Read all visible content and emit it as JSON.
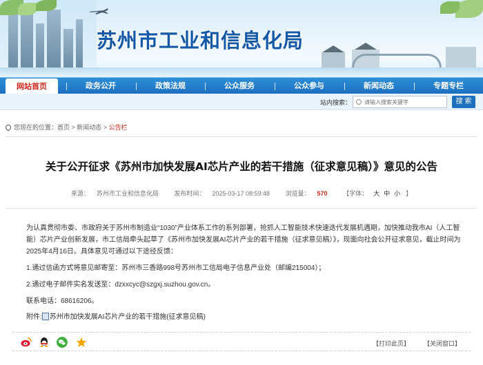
{
  "site": {
    "title": "苏州市工业和信息化局"
  },
  "nav": {
    "items": [
      {
        "label": "网站首页",
        "active": true
      },
      {
        "label": "政务公开"
      },
      {
        "label": "政策法规"
      },
      {
        "label": "公众服务"
      },
      {
        "label": "公众参与"
      },
      {
        "label": "新闻动态"
      },
      {
        "label": "专题专栏"
      }
    ]
  },
  "search": {
    "label": "站内搜索：",
    "placeholder": "请输入搜索关键字",
    "button": "搜 索"
  },
  "breadcrumb": {
    "prefix": "您现在的位置：",
    "home": "首页",
    "sep1": " > ",
    "section": "新闻动态",
    "sep2": " > ",
    "current": "公告栏"
  },
  "article": {
    "title": "关于公开征求《苏州市加快发展AI芯片产业的若干措施（征求意见稿）》意见的公告",
    "meta": {
      "source_label": "来源：",
      "source": "苏州市工业和信息化局",
      "date_label": "发布时间：",
      "date": "2025-03-17 08:59:48",
      "views_label": "浏览量：",
      "views": "570",
      "font_label": "【字体：",
      "font_large": "大",
      "font_medium": "中",
      "font_small": "小",
      "font_close": "】"
    },
    "paragraph": "为认真贯彻市委、市政府关于苏州市制造业“1030”产业体系工作的系列部署，抢抓人工智能技术快速迭代发展机遇期，加快推动我市AI（人工智能）芯片产业创新发展，市工信局牵头起草了《苏州市加快发展AI芯片产业的若干措施（征求意见稿）》，现面向社会公开征求意见，截止时间为2025年4月16日。具体意见可通过以下途径反馈：",
    "item1": "1.通过信函方式将意见邮寄至：苏州市三香路998号苏州市工信局电子信息产业处（邮编215004）；",
    "item2": "2.通过电子邮件实名发送至：dzxxcyc@szgxj.suzhou.gov.cn。",
    "phone": "联系电话：68616206。",
    "attachment_label": "附件:",
    "attachment": "苏州市加快发展AI芯片产业的若干措施(征求意见稿)"
  },
  "footer": {
    "print": "【打印此页】",
    "close": "【关闭窗口】"
  },
  "share_icons": [
    "weibo-icon",
    "qq-icon",
    "wechat-icon",
    "favorite-star-icon"
  ],
  "colors": {
    "brand_blue": "#1d6fbf",
    "title_blue": "#1558a8",
    "accent_red": "#d4281c"
  }
}
